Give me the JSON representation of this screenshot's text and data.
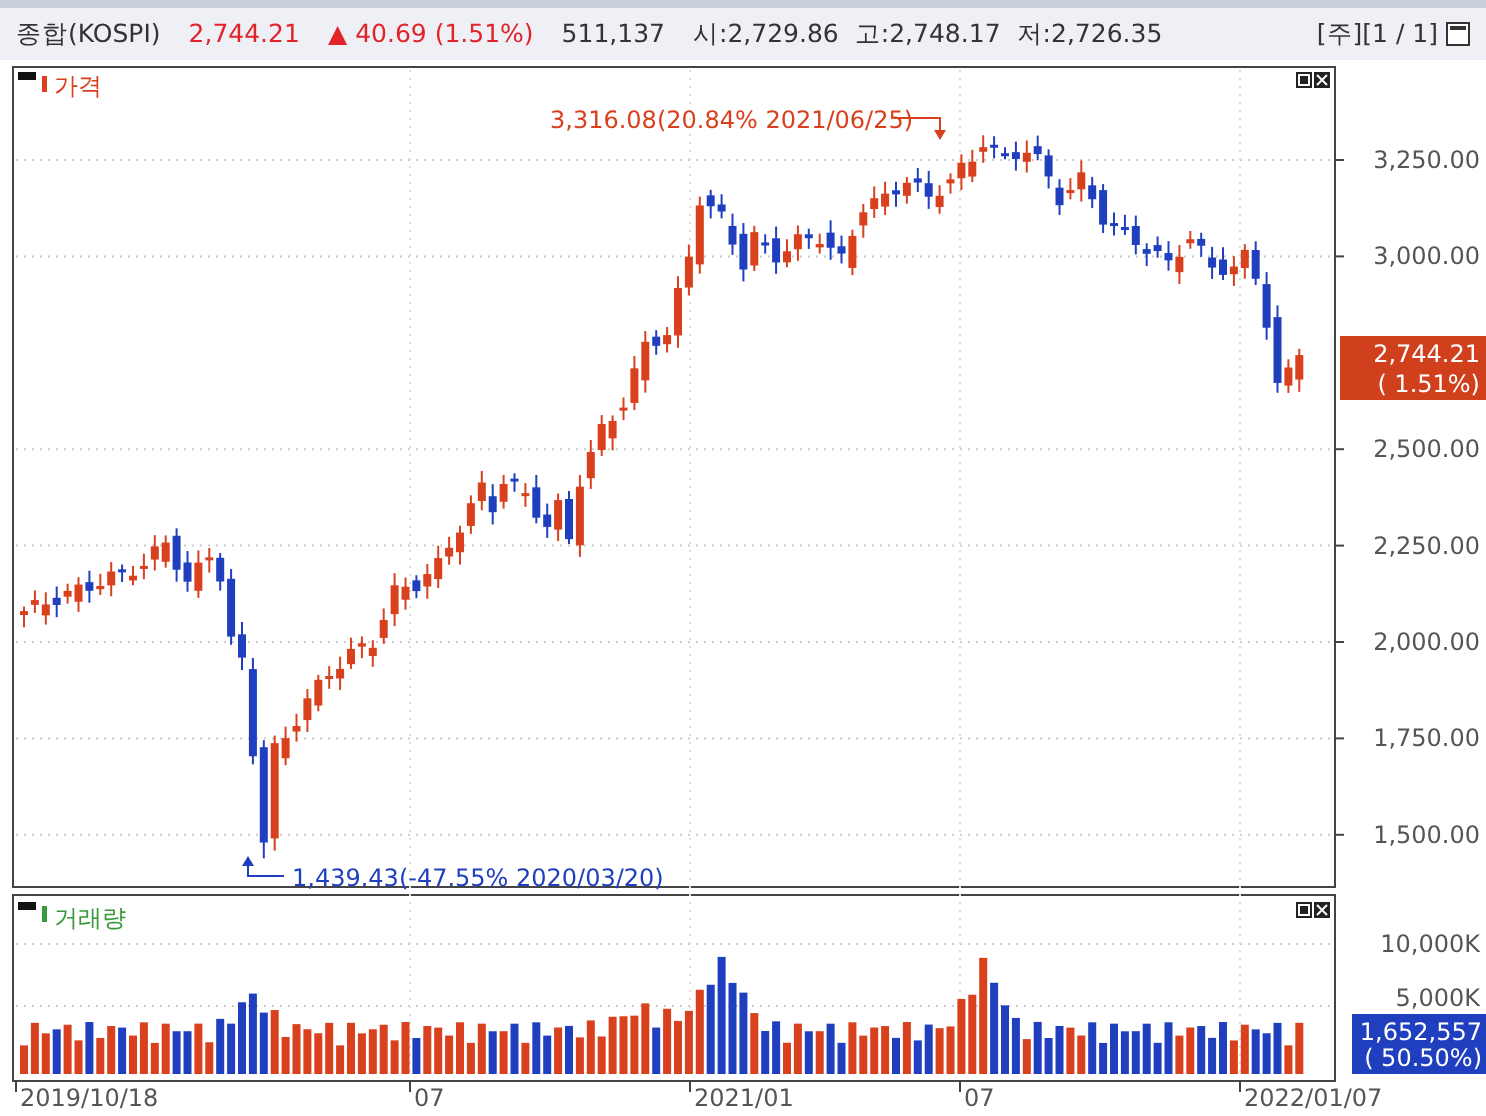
{
  "quote_bar": {
    "name": "종합(KOSPI)",
    "price": "2,744.21",
    "change_icon": "▲",
    "change": "40.69 (1.51%)",
    "volume": "511,137",
    "open": "시:2,729.86",
    "high": "고:2,748.17",
    "low": "저:2,726.35",
    "period": "[주][1 / 1]"
  },
  "price_panel": {
    "title": "가격",
    "y_ticks": [
      "3,250.00",
      "3,000.00",
      "2,500.00",
      "2,250.00",
      "2,000.00",
      "1,750.00",
      "1,500.00"
    ],
    "high_note": "3,316.08(20.84% 2021/06/25)",
    "low_note": "1,439.43(-47.55% 2020/03/20)",
    "last_price": "2,744.21",
    "last_change": "( 1.51%)"
  },
  "volume_panel": {
    "title": "거래량",
    "y_ticks": [
      "10,000K",
      "5,000K"
    ],
    "last_volume": "1,652,557",
    "last_ratio": "( 50.50%)"
  },
  "x_axis": [
    "2019/10/18",
    "07",
    "2021/01",
    "07",
    "2022/01/07"
  ]
}
